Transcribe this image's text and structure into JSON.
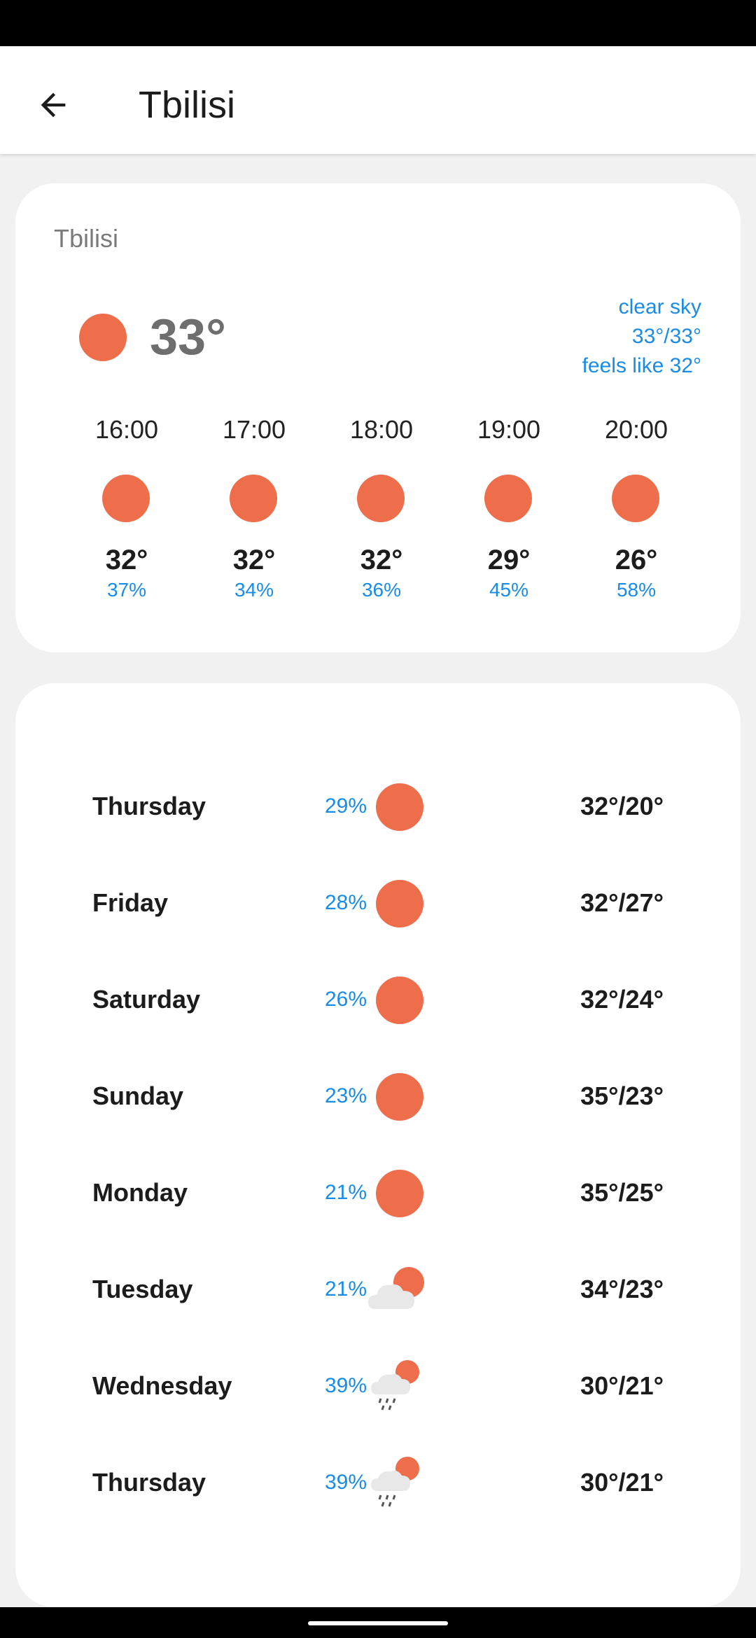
{
  "header": {
    "title": "Tbilisi"
  },
  "current": {
    "city": "Tbilisi",
    "temp": "33°",
    "icon": "sun-icon",
    "description": "clear sky",
    "min_max": "33°/33°",
    "feels_like": "feels like 32°"
  },
  "hourly": [
    {
      "time": "16:00",
      "temp": "32°",
      "pop": "37%",
      "icon": "sun-icon"
    },
    {
      "time": "17:00",
      "temp": "32°",
      "pop": "34%",
      "icon": "sun-icon"
    },
    {
      "time": "18:00",
      "temp": "32°",
      "pop": "36%",
      "icon": "sun-icon"
    },
    {
      "time": "19:00",
      "temp": "29°",
      "pop": "45%",
      "icon": "sun-icon"
    },
    {
      "time": "20:00",
      "temp": "26°",
      "pop": "58%",
      "icon": "sun-icon"
    }
  ],
  "daily": [
    {
      "day": "Thursday",
      "pop": "29%",
      "temps": "32°/20°",
      "icon": "sun-icon"
    },
    {
      "day": "Friday",
      "pop": "28%",
      "temps": "32°/27°",
      "icon": "sun-icon"
    },
    {
      "day": "Saturday",
      "pop": "26%",
      "temps": "32°/24°",
      "icon": "sun-icon"
    },
    {
      "day": "Sunday",
      "pop": "23%",
      "temps": "35°/23°",
      "icon": "sun-icon"
    },
    {
      "day": "Monday",
      "pop": "21%",
      "temps": "35°/25°",
      "icon": "sun-icon"
    },
    {
      "day": "Tuesday",
      "pop": "21%",
      "temps": "34°/23°",
      "icon": "partly-cloudy-icon"
    },
    {
      "day": "Wednesday",
      "pop": "39%",
      "temps": "30°/21°",
      "icon": "rain-sun-icon"
    },
    {
      "day": "Thursday",
      "pop": "39%",
      "temps": "30°/21°",
      "icon": "rain-sun-icon"
    }
  ],
  "colors": {
    "sun": "#ee6e4c",
    "accent": "#1a8ce6",
    "cloud": "#e8e8e8"
  }
}
